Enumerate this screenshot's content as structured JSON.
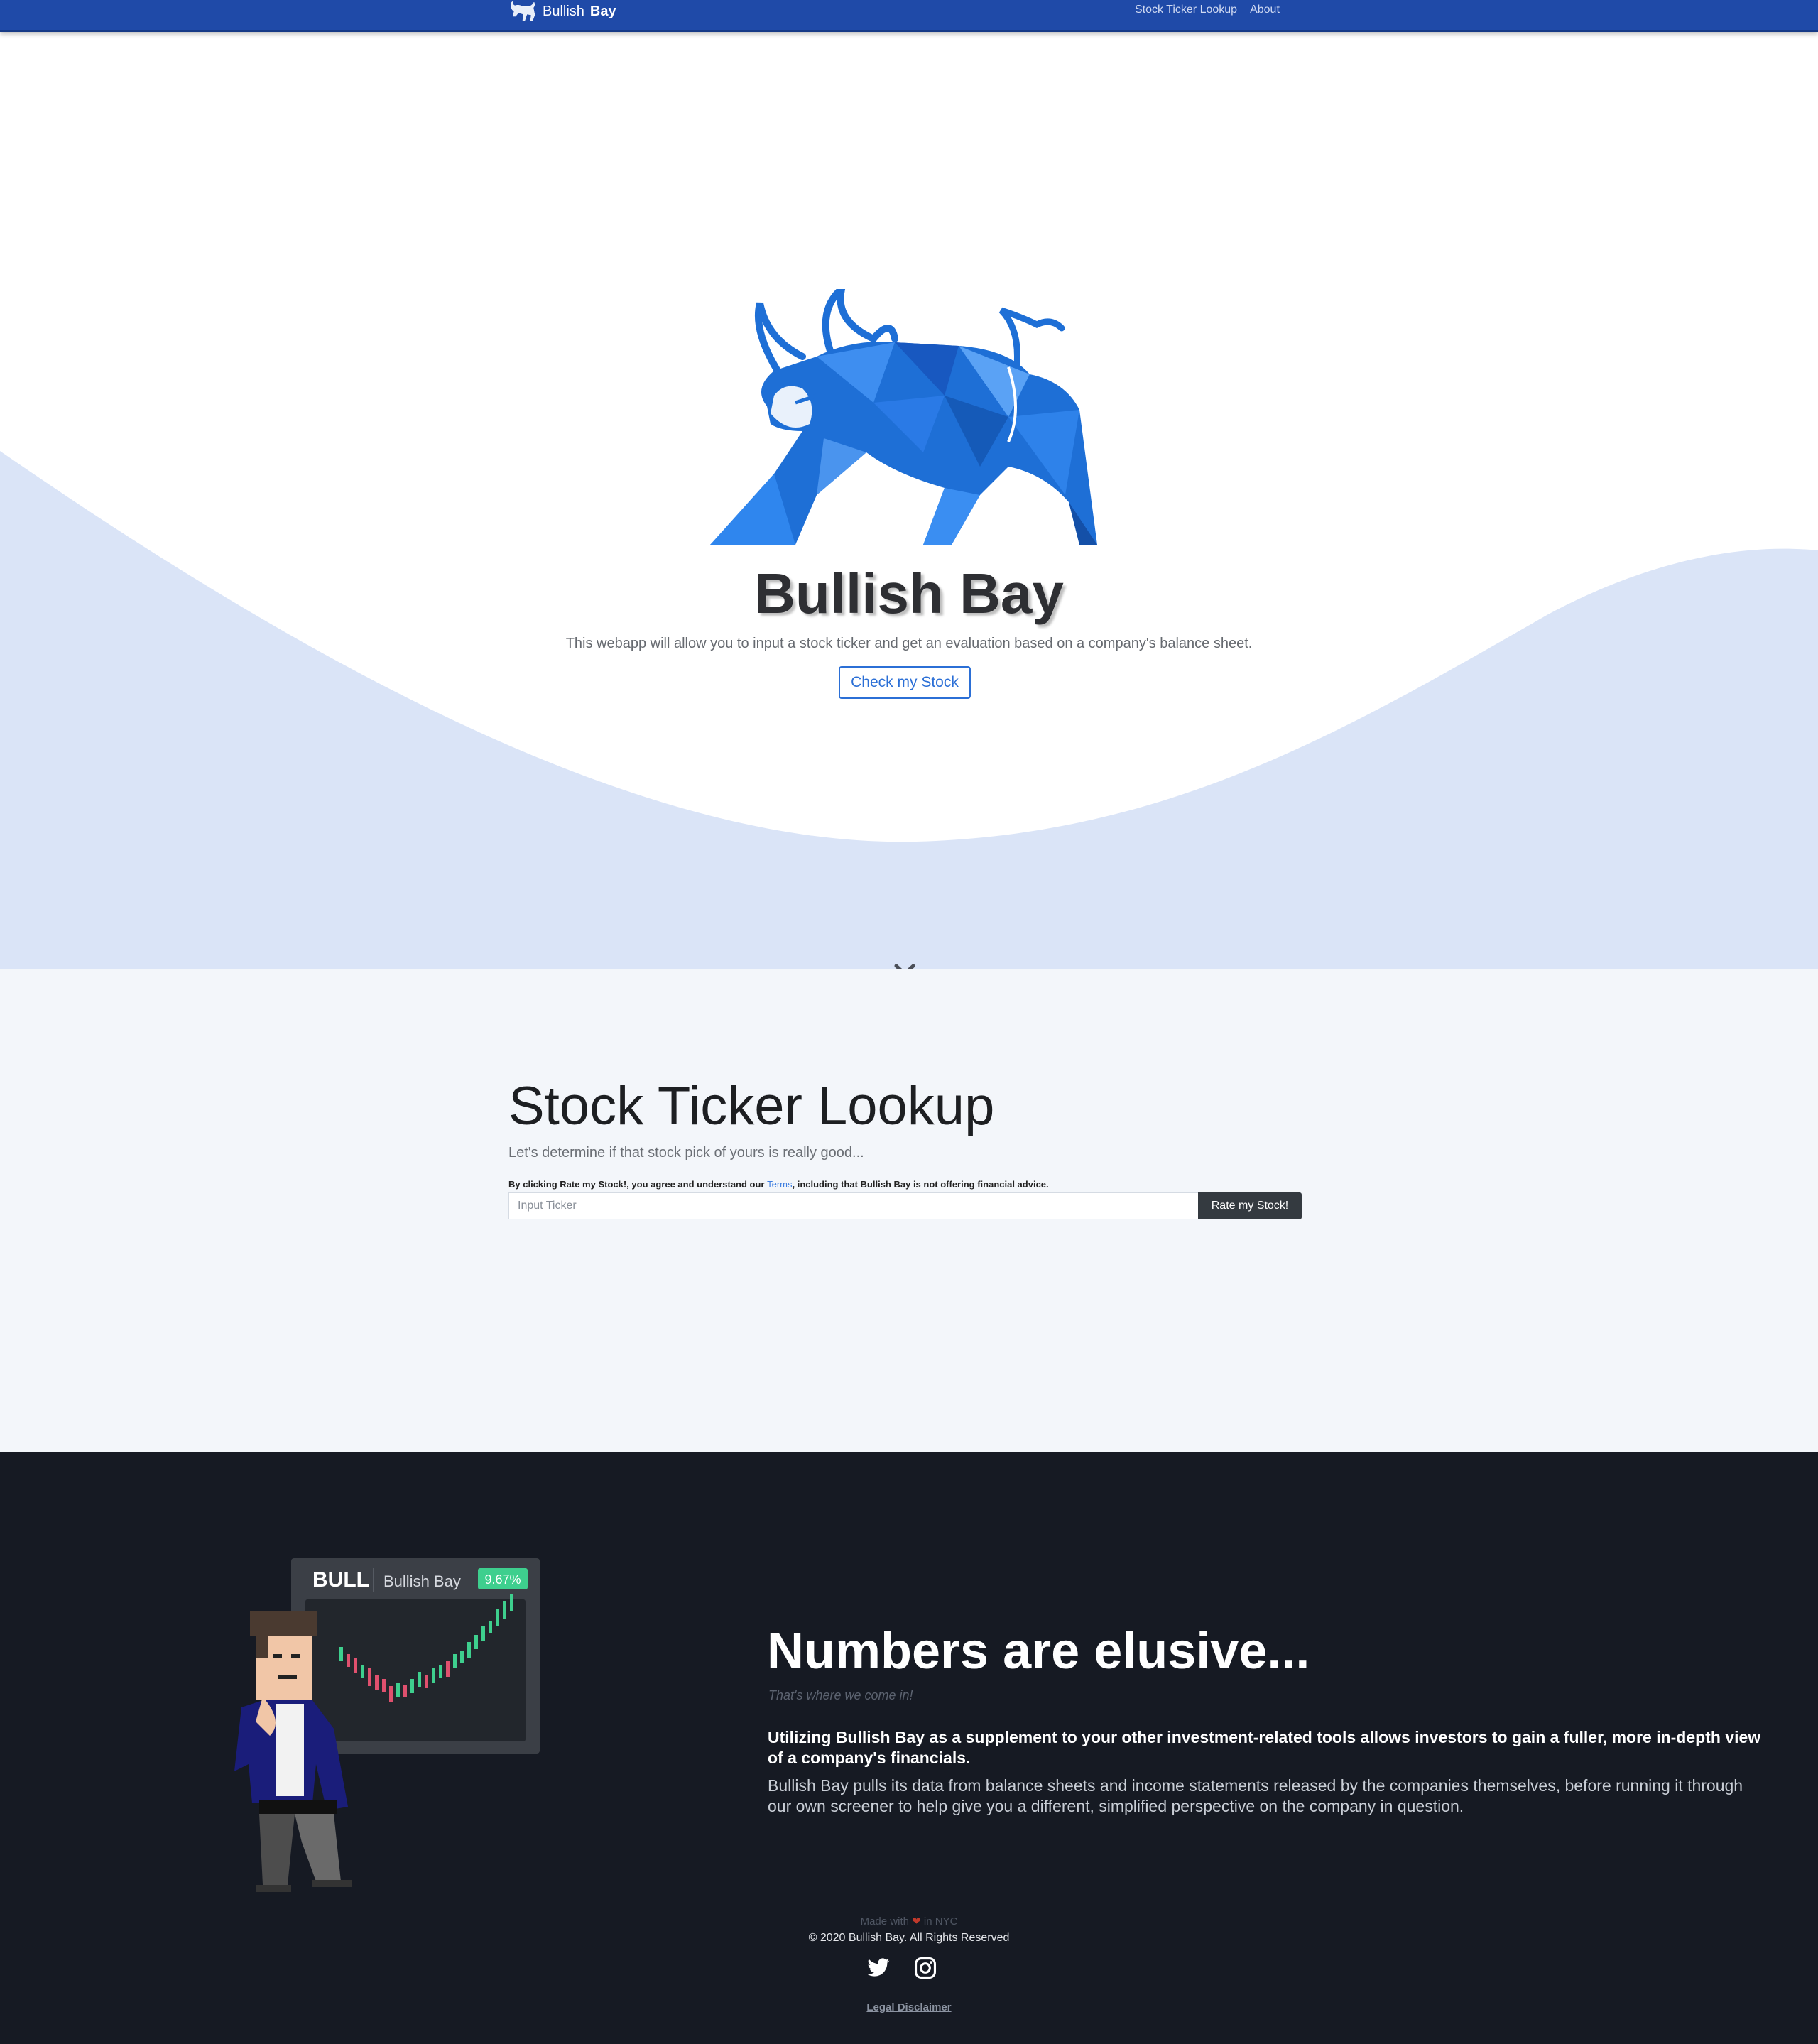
{
  "navbar": {
    "brand_light": "Bullish",
    "brand_bold": "Bay",
    "links": [
      "Stock Ticker Lookup",
      "About"
    ]
  },
  "hero": {
    "title": "Bullish Bay",
    "subtitle": "This webapp will allow you to input a stock ticker and get an evaluation based on a company's balance sheet.",
    "button_label": "Check my Stock"
  },
  "lookup": {
    "title": "Stock Ticker Lookup",
    "subtitle": "Let's determine if that stock pick of yours is really good...",
    "terms_before": "By clicking Rate my Stock!, you agree and understand our ",
    "terms_link": "Terms",
    "terms_after": ", including that Bullish Bay is not offering financial advice.",
    "input_placeholder": "Input Ticker",
    "button_label": "Rate my Stock!"
  },
  "illustration": {
    "ticker": "BULL",
    "name": "Bullish Bay",
    "change": "9.67%"
  },
  "about": {
    "title": "Numbers are elusive...",
    "tagline": "That's where we come in!",
    "lead": "Utilizing Bullish Bay as a supplement to your other investment-related tools allows investors to gain a fuller, more in-depth view of a company's financials.",
    "body": "Bullish Bay pulls its data from balance sheets and income statements released by the companies themselves, before running it through our own screener to help give you a different, simplified perspective on the company in question."
  },
  "footer": {
    "made_with_before": "Made with ",
    "made_with_after": " in NYC",
    "copyright": "© 2020 Bullish Bay. All Rights Reserved",
    "legal": "Legal Disclaimer"
  },
  "icons": {
    "brand": "bull-logo-icon",
    "scroll": "chevron-down-icon",
    "heart": "heart-icon",
    "social": [
      "twitter-icon",
      "instagram-icon"
    ]
  },
  "colors": {
    "navbar": "#1f4aa8",
    "accent": "#2b6fd6",
    "wave": "#dae4f7",
    "lookup_bg": "#f3f6fa",
    "footer_bg": "#161a23",
    "up_candle": "#3ecf8e",
    "down_candle": "#e0506e"
  }
}
